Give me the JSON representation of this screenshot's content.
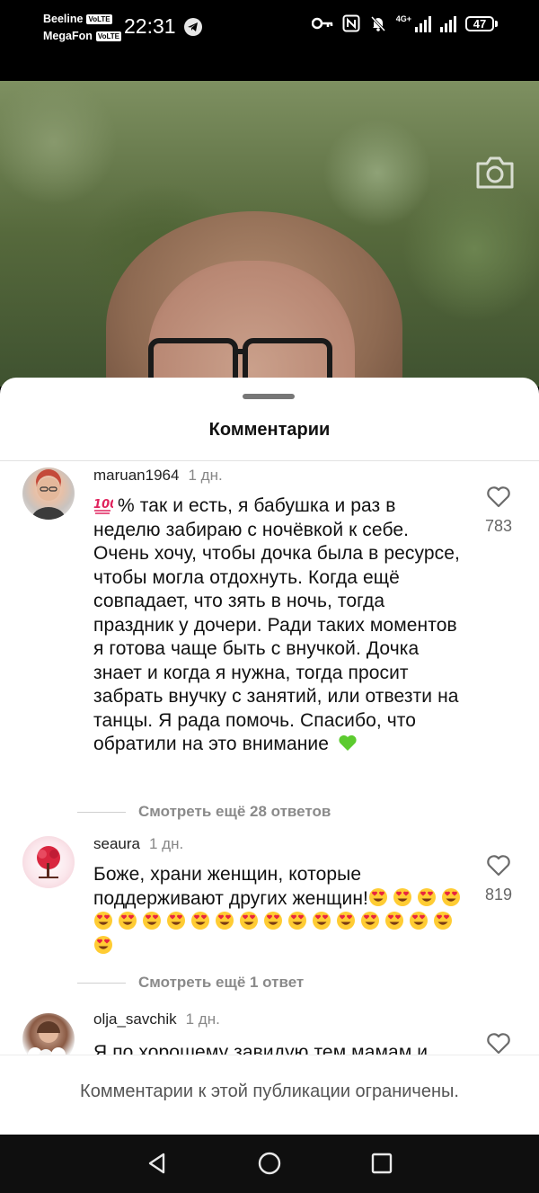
{
  "status_bar": {
    "carrier_1": "Beeline",
    "carrier_2": "MegaFon",
    "volte_badge": "VoLTE",
    "time": "22:31",
    "network_label": "4G+",
    "battery_level": "47",
    "icons": [
      "telegram-icon",
      "key-icon",
      "nfc-icon",
      "bell-muted-icon",
      "signal-icon",
      "battery-icon"
    ]
  },
  "photo": {
    "icons": [
      "camera-icon"
    ]
  },
  "sheet": {
    "title": "Комментарии",
    "restricted_message": "Комментарии к этой публикации ограничены."
  },
  "comments": [
    {
      "username": "maruan1964",
      "time": "1 дн.",
      "prefix_emoji": "hundred-points-emoji",
      "text": "% так и есть, я бабушка и раз в неделю забираю с ночёвкой к себе. Очень хочу, чтобы дочка была в ресурсе, чтобы могла отдохнуть. Когда ещё совпадает, что зять в ночь, тогда праздник у дочери. Ради таких моментов я готова чаще быть с внучкой. Дочка знает и когда я нужна, тогда просит забрать внучку с занятий, или отвезти на танцы. Я рада помочь. Спасибо, что обратили на это внимание",
      "suffix_emoji": "green-heart-emoji",
      "likes": "783",
      "replies_link": "Смотреть ещё 28 ответов"
    },
    {
      "username": "seaura",
      "time": "1 дн.",
      "text": "Боже, храни женщин, которые поддерживают других женщин!",
      "emoji_count": 20,
      "emoji_name": "heart-eyes-emoji",
      "likes": "819",
      "replies_link": "Смотреть ещё 1 ответ"
    },
    {
      "username": "olja_savchik",
      "time": "1 дн.",
      "text": "Я по хорошему завидую тем мамам и"
    }
  ],
  "nav_bar": {
    "icons": [
      "back-icon",
      "home-icon",
      "recents-icon"
    ]
  }
}
